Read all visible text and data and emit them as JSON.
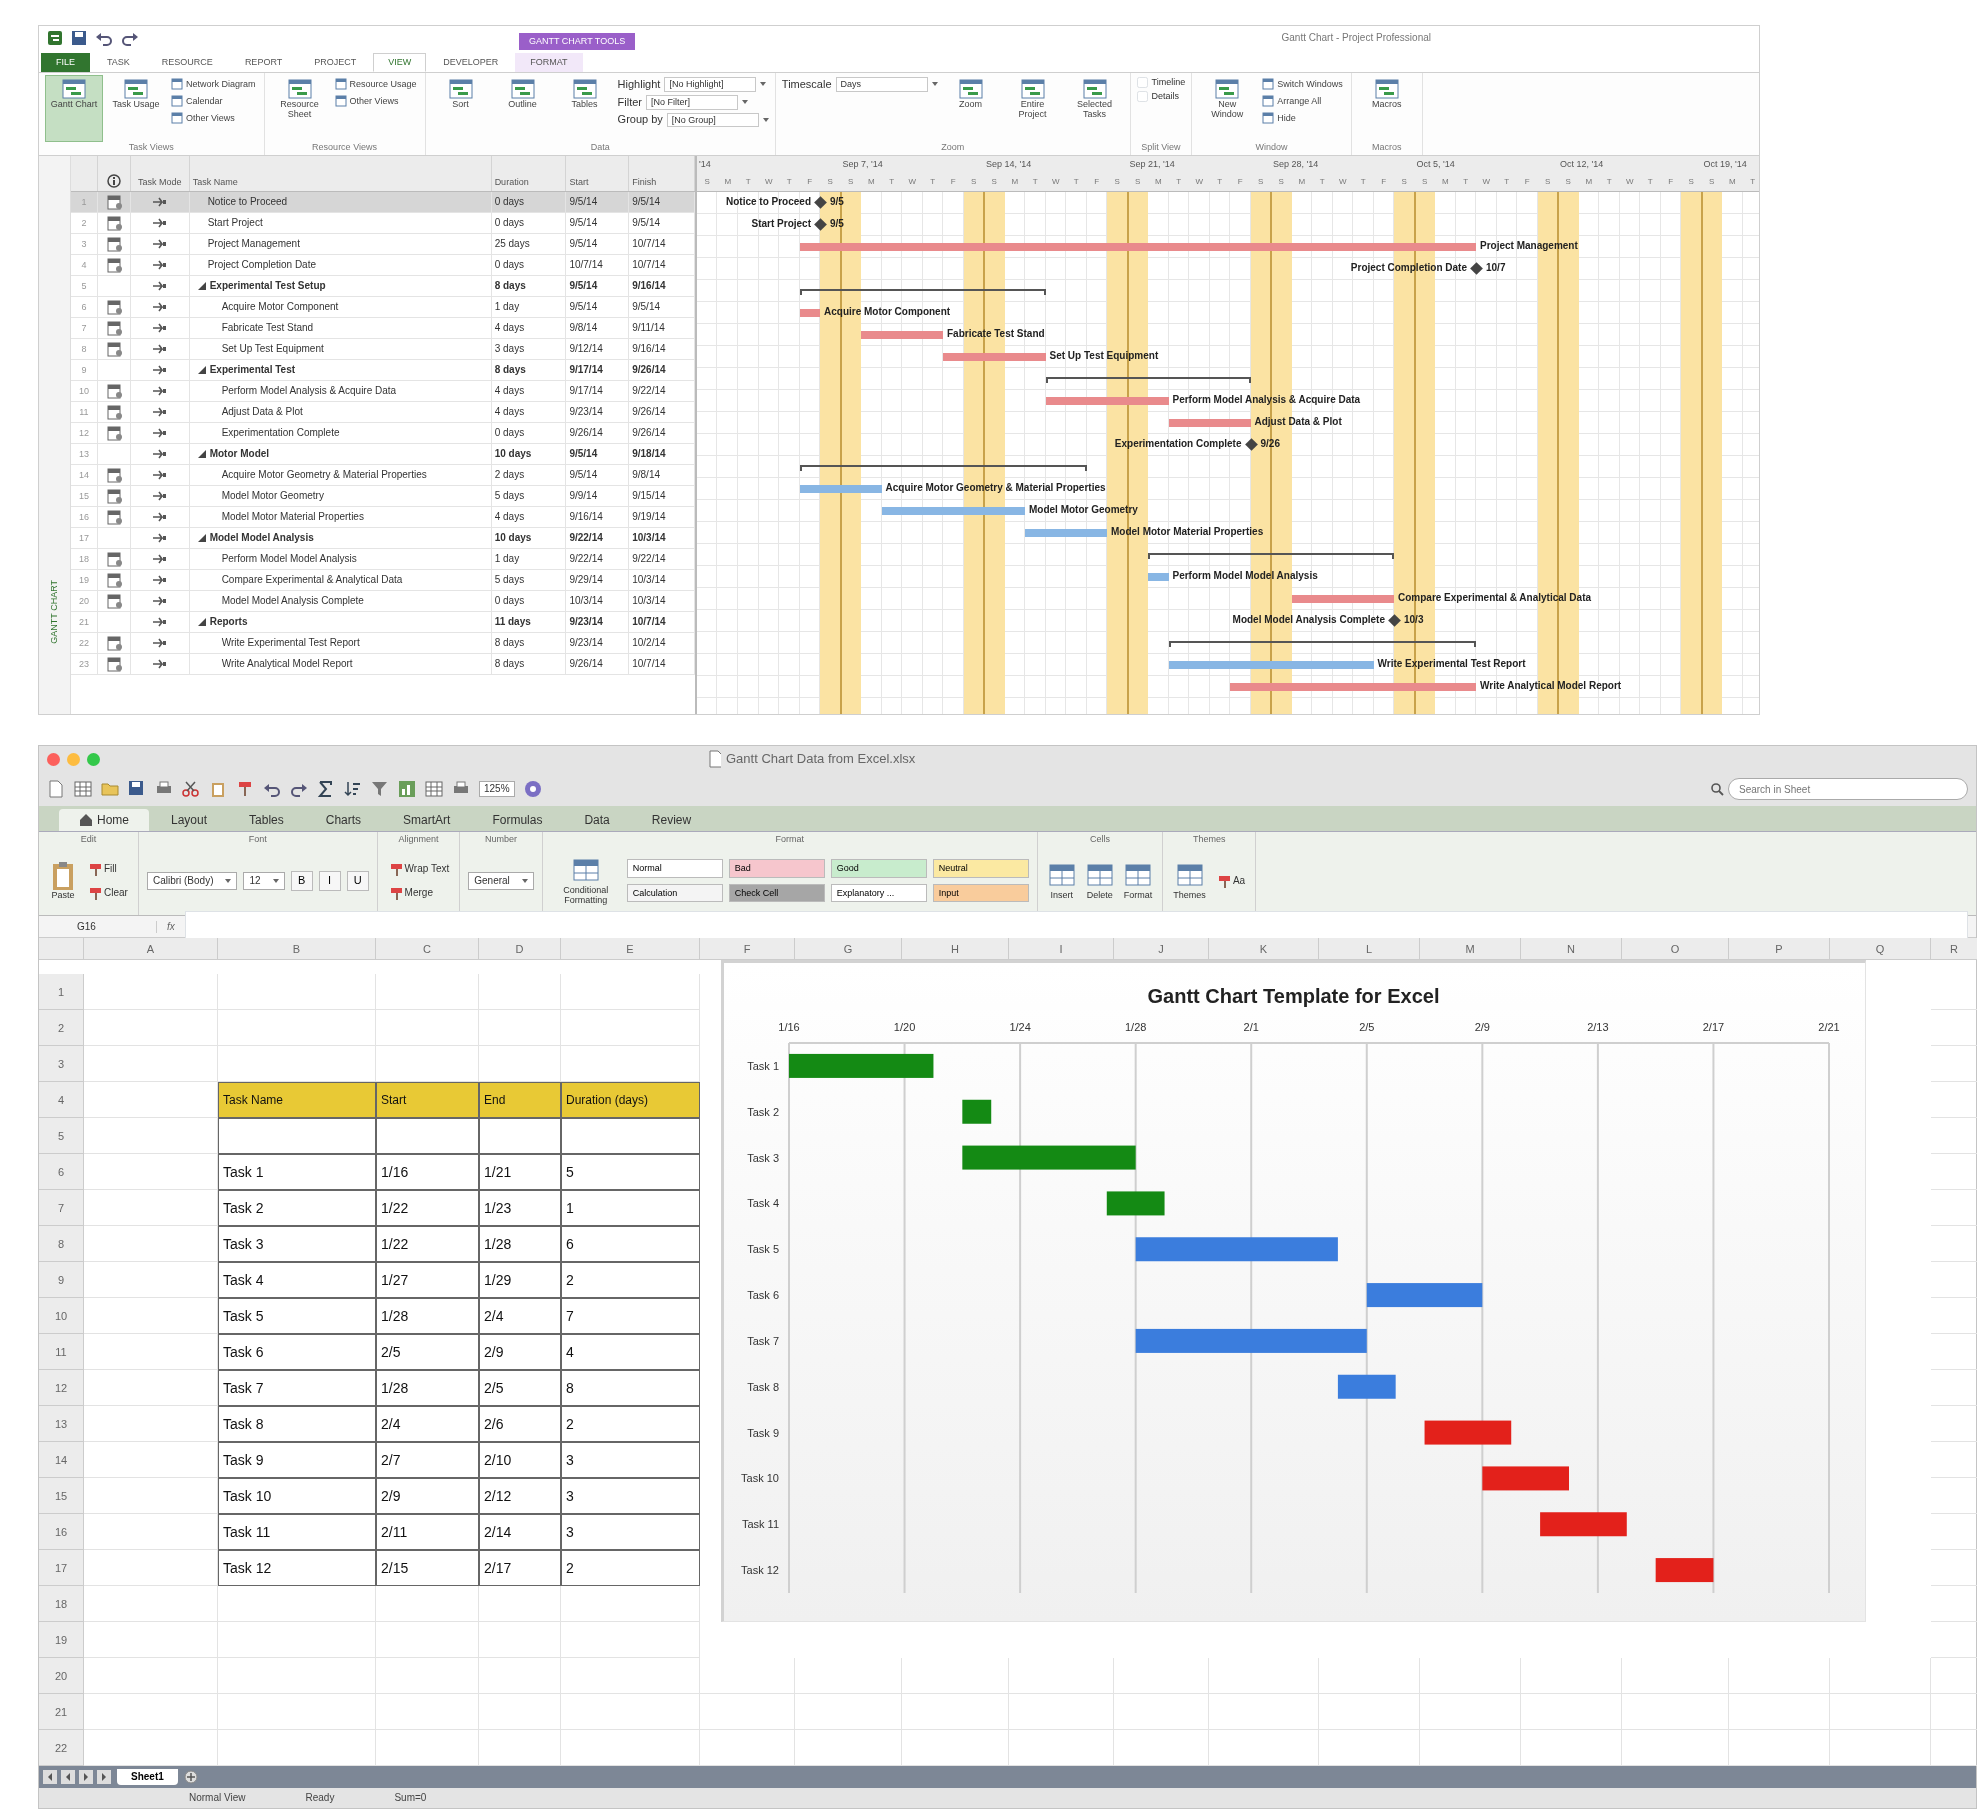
{
  "project": {
    "context_tab": "GANTT CHART TOOLS",
    "title": "Gantt Chart - Project Professional",
    "tabs": [
      {
        "label": "FILE",
        "kind": "file",
        "selected": false
      },
      {
        "label": "TASK",
        "kind": "normal",
        "selected": false
      },
      {
        "label": "RESOURCE",
        "kind": "normal",
        "selected": false
      },
      {
        "label": "REPORT",
        "kind": "normal",
        "selected": false
      },
      {
        "label": "PROJECT",
        "kind": "normal",
        "selected": false
      },
      {
        "label": "VIEW",
        "kind": "normal",
        "selected": true
      },
      {
        "label": "DEVELOPER",
        "kind": "normal",
        "selected": false
      },
      {
        "label": "FORMAT",
        "kind": "context",
        "selected": false
      }
    ],
    "ribbon": [
      {
        "label": "Task Views",
        "items": [
          {
            "kind": "large",
            "label": "Gantt Chart",
            "selected": true
          },
          {
            "kind": "large",
            "label": "Task Usage",
            "selected": false
          },
          {
            "kind": "small",
            "label": "Network Diagram",
            "selected": false
          },
          {
            "kind": "small",
            "label": "Calendar",
            "selected": false
          },
          {
            "kind": "small",
            "label": "Other Views",
            "selected": false
          }
        ]
      },
      {
        "label": "Resource Views",
        "items": [
          {
            "kind": "large",
            "label": "Resource Sheet",
            "selected": false
          },
          {
            "kind": "small",
            "label": "Resource Usage",
            "selected": false
          },
          {
            "kind": "small",
            "label": "Other Views",
            "selected": false
          }
        ]
      },
      {
        "label": "Data",
        "items": [
          {
            "kind": "large",
            "label": "Sort"
          },
          {
            "kind": "large",
            "label": "Outline"
          },
          {
            "kind": "large",
            "label": "Tables"
          },
          {
            "kind": "combo",
            "label": "Highlight",
            "value": "[No Highlight]"
          },
          {
            "kind": "combo",
            "label": "Filter",
            "value": "[No Filter]"
          },
          {
            "kind": "combo",
            "label": "Group by",
            "value": "[No Group]"
          }
        ]
      },
      {
        "label": "Zoom",
        "items": [
          {
            "kind": "combo",
            "label": "Timescale",
            "value": "Days"
          },
          {
            "kind": "large",
            "label": "Zoom"
          },
          {
            "kind": "large",
            "label": "Entire Project"
          },
          {
            "kind": "large",
            "label": "Selected Tasks"
          }
        ]
      },
      {
        "label": "Split View",
        "items": [
          {
            "kind": "check",
            "label": "Timeline",
            "checked": false
          },
          {
            "kind": "check",
            "label": "Details",
            "checked": false
          }
        ]
      },
      {
        "label": "Window",
        "items": [
          {
            "kind": "large",
            "label": "New Window"
          },
          {
            "kind": "small",
            "label": "Switch Windows"
          },
          {
            "kind": "small",
            "label": "Arrange All"
          },
          {
            "kind": "small",
            "label": "Hide"
          }
        ]
      },
      {
        "label": "Macros",
        "items": [
          {
            "kind": "large",
            "label": "Macros"
          }
        ]
      }
    ],
    "sidebar_label": "GANTT CHART",
    "columns": [
      "Task Mode",
      "Task Name",
      "Duration",
      "Start",
      "Finish"
    ],
    "timescale": {
      "weeks": [
        "'14",
        "Sep 7, '14",
        "Sep 14, '14",
        "Sep 21, '14",
        "Sep 28, '14",
        "Oct 5, '14",
        "Oct 12, '14",
        "Oct 19, '14"
      ],
      "days": [
        "S",
        "M",
        "T",
        "W",
        "T",
        "F",
        "S",
        "S",
        "M",
        "T",
        "W",
        "T",
        "F",
        "S",
        "S",
        "M",
        "T",
        "W",
        "T",
        "F",
        "S",
        "S",
        "M",
        "T",
        "W",
        "T",
        "F",
        "S",
        "S",
        "M",
        "T",
        "W",
        "T",
        "F",
        "S",
        "S",
        "M",
        "T",
        "W",
        "T",
        "F",
        "S",
        "S",
        "M",
        "T",
        "W",
        "T",
        "F",
        "S",
        "S",
        "M",
        "T"
      ]
    },
    "tasks": [
      {
        "row": "1",
        "name": "Notice to Proceed",
        "duration": "0 days",
        "start": "9/5/14",
        "finish": "9/5/14",
        "kind": "milestone",
        "selected": true,
        "gantt_label": "Notice to Proceed",
        "gantt_date": "9/5"
      },
      {
        "row": "2",
        "name": "Start Project",
        "duration": "0 days",
        "start": "9/5/14",
        "finish": "9/5/14",
        "kind": "milestone",
        "selected": false,
        "gantt_label": "Start Project",
        "gantt_date": "9/5"
      },
      {
        "row": "3",
        "name": "Project Management",
        "duration": "25 days",
        "start": "9/5/14",
        "finish": "10/7/14",
        "kind": "task",
        "selected": false,
        "color": "#e98a8c",
        "gantt_label": "Project Management"
      },
      {
        "row": "4",
        "name": "Project Completion Date",
        "duration": "0 days",
        "start": "10/7/14",
        "finish": "10/7/14",
        "kind": "milestone",
        "selected": false,
        "gantt_label": "Project Completion Date",
        "gantt_date": "10/7"
      },
      {
        "row": "5",
        "name": "Experimental Test Setup",
        "duration": "8 days",
        "start": "9/5/14",
        "finish": "9/16/14",
        "kind": "summary",
        "selected": false,
        "expanded": true,
        "children": [
          {
            "row": "6",
            "name": "Acquire Motor Component",
            "duration": "1 day",
            "start": "9/5/14",
            "finish": "9/5/14",
            "kind": "task",
            "selected": false,
            "color": "#e98a8c",
            "gantt_label": "Acquire Motor Component"
          },
          {
            "row": "7",
            "name": "Fabricate Test Stand",
            "duration": "4 days",
            "start": "9/8/14",
            "finish": "9/11/14",
            "kind": "task",
            "selected": false,
            "color": "#e98a8c",
            "gantt_label": "Fabricate Test Stand"
          },
          {
            "row": "8",
            "name": "Set Up Test Equipment",
            "duration": "3 days",
            "start": "9/12/14",
            "finish": "9/16/14",
            "kind": "task",
            "selected": false,
            "color": "#e98a8c",
            "gantt_label": "Set Up Test Equipment"
          }
        ]
      },
      {
        "row": "9",
        "name": "Experimental Test",
        "duration": "8 days",
        "start": "9/17/14",
        "finish": "9/26/14",
        "kind": "summary",
        "selected": false,
        "expanded": true,
        "children": [
          {
            "row": "10",
            "name": "Perform Model Analysis & Acquire Data",
            "duration": "4 days",
            "start": "9/17/14",
            "finish": "9/22/14",
            "kind": "task",
            "selected": false,
            "color": "#e98a8c",
            "gantt_label": "Perform Model Analysis & Acquire Data"
          },
          {
            "row": "11",
            "name": "Adjust Data & Plot",
            "duration": "4 days",
            "start": "9/23/14",
            "finish": "9/26/14",
            "kind": "task",
            "selected": false,
            "color": "#e98a8c",
            "gantt_label": "Adjust Data & Plot"
          },
          {
            "row": "12",
            "name": "Experimentation Complete",
            "duration": "0 days",
            "start": "9/26/14",
            "finish": "9/26/14",
            "kind": "milestone",
            "selected": false,
            "gantt_label": "Experimentation Complete",
            "gantt_date": "9/26"
          }
        ]
      },
      {
        "row": "13",
        "name": "Motor Model",
        "duration": "10 days",
        "start": "9/5/14",
        "finish": "9/18/14",
        "kind": "summary",
        "selected": false,
        "expanded": true,
        "children": [
          {
            "row": "14",
            "name": "Acquire Motor Geometry & Material Properties",
            "duration": "2 days",
            "start": "9/5/14",
            "finish": "9/8/14",
            "kind": "task",
            "selected": false,
            "color": "#88b6e4",
            "gantt_label": "Acquire Motor Geometry & Material Properties"
          },
          {
            "row": "15",
            "name": "Model Motor Geometry",
            "duration": "5 days",
            "start": "9/9/14",
            "finish": "9/15/14",
            "kind": "task",
            "selected": false,
            "color": "#88b6e4",
            "gantt_label": "Model Motor Geometry"
          },
          {
            "row": "16",
            "name": "Model Motor Material Properties",
            "duration": "4 days",
            "start": "9/16/14",
            "finish": "9/19/14",
            "kind": "task",
            "selected": false,
            "color": "#88b6e4",
            "gantt_label": "Model Motor Material Properties"
          }
        ]
      },
      {
        "row": "17",
        "name": "Model Model Analysis",
        "duration": "10 days",
        "start": "9/22/14",
        "finish": "10/3/14",
        "kind": "summary",
        "selected": false,
        "expanded": true,
        "children": [
          {
            "row": "18",
            "name": "Perform Model Model Analysis",
            "duration": "1 day",
            "start": "9/22/14",
            "finish": "9/22/14",
            "kind": "task",
            "selected": false,
            "color": "#88b6e4",
            "gantt_label": "Perform Model Model Analysis"
          },
          {
            "row": "19",
            "name": "Compare Experimental & Analytical Data",
            "duration": "5 days",
            "start": "9/29/14",
            "finish": "10/3/14",
            "kind": "task",
            "selected": false,
            "color": "#e98a8c",
            "gantt_label": "Compare Experimental & Analytical Data"
          },
          {
            "row": "20",
            "name": "Model Model Analysis Complete",
            "duration": "0 days",
            "start": "10/3/14",
            "finish": "10/3/14",
            "kind": "milestone",
            "selected": false,
            "gantt_label": "Model Model Analysis Complete",
            "gantt_date": "10/3"
          }
        ]
      },
      {
        "row": "21",
        "name": "Reports",
        "duration": "11 days",
        "start": "9/23/14",
        "finish": "10/7/14",
        "kind": "summary",
        "selected": false,
        "expanded": true,
        "children": [
          {
            "row": "22",
            "name": "Write Experimental Test Report",
            "duration": "8 days",
            "start": "9/23/14",
            "finish": "10/2/14",
            "kind": "task",
            "selected": false,
            "color": "#88b6e4",
            "gantt_label": "Write Experimental Test Report"
          },
          {
            "row": "23",
            "name": "Write Analytical Model Report",
            "duration": "8 days",
            "start": "9/26/14",
            "finish": "10/7/14",
            "kind": "task",
            "selected": false,
            "color": "#e98a8c",
            "gantt_label": "Write Analytical Model Report"
          }
        ]
      }
    ]
  },
  "excel": {
    "title": "Gantt Chart Data from Excel.xlsx",
    "zoom": "125%",
    "search": {
      "placeholder": "Search in Sheet"
    },
    "tabs": [
      {
        "label": "Home",
        "selected": true
      },
      {
        "label": "Layout",
        "selected": false
      },
      {
        "label": "Tables",
        "selected": false
      },
      {
        "label": "Charts",
        "selected": false
      },
      {
        "label": "SmartArt",
        "selected": false
      },
      {
        "label": "Formulas",
        "selected": false
      },
      {
        "label": "Data",
        "selected": false
      },
      {
        "label": "Review",
        "selected": false
      }
    ],
    "ribbon": [
      {
        "label": "Edit",
        "items": [
          {
            "kind": "large",
            "label": "Paste"
          },
          {
            "kind": "small",
            "label": "Fill"
          },
          {
            "kind": "small",
            "label": "Clear"
          }
        ]
      },
      {
        "label": "Font",
        "items": [
          {
            "kind": "field",
            "value": "Calibri (Body)"
          },
          {
            "kind": "field",
            "value": "12"
          },
          {
            "kind": "key",
            "label": "B"
          },
          {
            "kind": "key",
            "label": "I"
          },
          {
            "kind": "key",
            "label": "U"
          }
        ]
      },
      {
        "label": "Alignment",
        "items": [
          {
            "kind": "small",
            "label": "Wrap Text"
          },
          {
            "kind": "small",
            "label": "Merge"
          }
        ]
      },
      {
        "label": "Number",
        "items": [
          {
            "kind": "field",
            "value": "General"
          }
        ]
      },
      {
        "label": "Format",
        "button": "Conditional Formatting",
        "items": [
          {
            "kind": "style",
            "label": "Normal",
            "color": "#ffffff"
          },
          {
            "kind": "style",
            "label": "Bad",
            "color": "#f6c6cd"
          },
          {
            "kind": "style",
            "label": "Good",
            "color": "#c8eccd"
          },
          {
            "kind": "style",
            "label": "Neutral",
            "color": "#fbe9a2"
          },
          {
            "kind": "style",
            "label": "Calculation",
            "color": "#f4f4f4"
          },
          {
            "kind": "style",
            "label": "Check Cell",
            "color": "#a6a6a6"
          },
          {
            "kind": "style",
            "label": "Explanatory ...",
            "color": "#ffffff"
          },
          {
            "kind": "style",
            "label": "Input",
            "color": "#f9cc9c"
          }
        ]
      },
      {
        "label": "Cells",
        "items": [
          {
            "kind": "large",
            "label": "Insert"
          },
          {
            "kind": "large",
            "label": "Delete"
          },
          {
            "kind": "large",
            "label": "Format"
          }
        ]
      },
      {
        "label": "Themes",
        "items": [
          {
            "kind": "large",
            "label": "Themes"
          },
          {
            "kind": "small",
            "label": "Aa"
          }
        ]
      }
    ],
    "name_box": "G16",
    "formula_symbol": "fx",
    "columns": [
      "A",
      "B",
      "C",
      "D",
      "E",
      "F",
      "G",
      "H",
      "I",
      "J",
      "K",
      "L",
      "M",
      "N",
      "O",
      "P",
      "Q",
      "R"
    ],
    "rows": [
      "1",
      "2",
      "3",
      "4",
      "5",
      "6",
      "7",
      "8",
      "9",
      "10",
      "11",
      "12",
      "13",
      "14",
      "15",
      "16",
      "17",
      "18",
      "19",
      "20",
      "21",
      "22"
    ],
    "table": {
      "header": [
        "Task Name",
        "Start",
        "End",
        "Duration (days)"
      ],
      "rows": [
        [
          "Task 1",
          "1/16",
          "1/21",
          "5"
        ],
        [
          "Task 2",
          "1/22",
          "1/23",
          "1"
        ],
        [
          "Task 3",
          "1/22",
          "1/28",
          "6"
        ],
        [
          "Task 4",
          "1/27",
          "1/29",
          "2"
        ],
        [
          "Task 5",
          "1/28",
          "2/4",
          "7"
        ],
        [
          "Task 6",
          "2/5",
          "2/9",
          "4"
        ],
        [
          "Task 7",
          "1/28",
          "2/5",
          "8"
        ],
        [
          "Task 8",
          "2/4",
          "2/6",
          "2"
        ],
        [
          "Task 9",
          "2/7",
          "2/10",
          "3"
        ],
        [
          "Task 10",
          "2/9",
          "2/12",
          "3"
        ],
        [
          "Task 11",
          "2/11",
          "2/14",
          "3"
        ],
        [
          "Task 12",
          "2/15",
          "2/17",
          "2"
        ]
      ]
    },
    "chart": {
      "title": "Gantt Chart Template for Excel",
      "axis_labels": [
        "1/16",
        "1/20",
        "1/24",
        "1/28",
        "2/1",
        "2/5",
        "2/9",
        "2/13",
        "2/17",
        "2/21"
      ],
      "bars": [
        {
          "label": "Task 1",
          "color": "#148a14"
        },
        {
          "label": "Task 2",
          "color": "#148a14"
        },
        {
          "label": "Task 3",
          "color": "#148a14"
        },
        {
          "label": "Task 4",
          "color": "#148a14"
        },
        {
          "label": "Task 5",
          "color": "#3b7ddd"
        },
        {
          "label": "Task 6",
          "color": "#3b7ddd"
        },
        {
          "label": "Task 7",
          "color": "#3b7ddd"
        },
        {
          "label": "Task 8",
          "color": "#3b7ddd"
        },
        {
          "label": "Task 9",
          "color": "#e3211b"
        },
        {
          "label": "Task 10",
          "color": "#e3211b"
        },
        {
          "label": "Task 11",
          "color": "#e3211b"
        },
        {
          "label": "Task 12",
          "color": "#e3211b"
        }
      ]
    },
    "sheet_tabs": [
      {
        "label": "Sheet1",
        "selected": true
      }
    ],
    "status": [
      "Normal View",
      "Ready",
      "Sum=0"
    ]
  }
}
